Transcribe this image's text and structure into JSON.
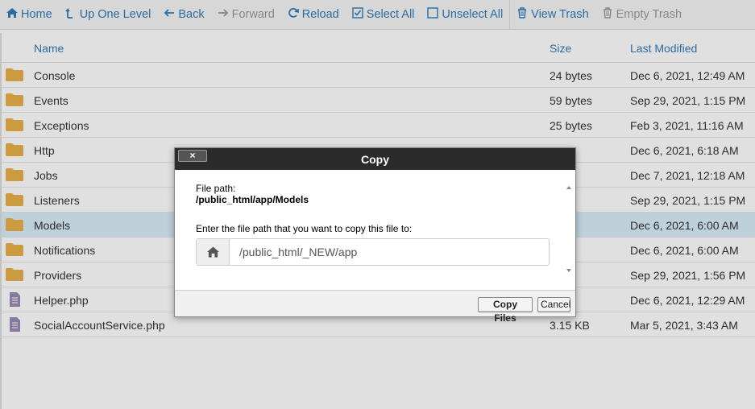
{
  "toolbar": {
    "items": [
      {
        "label": "Home",
        "icon": "home-icon",
        "disabled": false
      },
      {
        "label": "Up One Level",
        "icon": "level-up-icon",
        "disabled": false
      },
      {
        "label": "Back",
        "icon": "arrow-left-icon",
        "disabled": false
      },
      {
        "label": "Forward",
        "icon": "arrow-right-icon",
        "disabled": true
      },
      {
        "label": "Reload",
        "icon": "refresh-icon",
        "disabled": false
      },
      {
        "label": "Select All",
        "icon": "checkbox-checked-icon",
        "disabled": false
      },
      {
        "label": "Unselect All",
        "icon": "checkbox-empty-icon",
        "disabled": false
      },
      {
        "label": "View Trash",
        "icon": "trash-icon",
        "disabled": false
      },
      {
        "label": "Empty Trash",
        "icon": "trash-icon",
        "disabled": true
      }
    ]
  },
  "table": {
    "headers": {
      "name": "Name",
      "size": "Size",
      "modified": "Last Modified"
    },
    "rows": [
      {
        "name": "Console",
        "size": "24 bytes",
        "modified": "Dec 6, 2021, 12:49 AM",
        "type": "folder"
      },
      {
        "name": "Events",
        "size": "59 bytes",
        "modified": "Sep 29, 2021, 1:15 PM",
        "type": "folder"
      },
      {
        "name": "Exceptions",
        "size": "25 bytes",
        "modified": "Feb 3, 2021, 11:16 AM",
        "type": "folder"
      },
      {
        "name": "Http",
        "size": "",
        "modified": "Dec 6, 2021, 6:18 AM",
        "type": "folder"
      },
      {
        "name": "Jobs",
        "size": "",
        "modified": "Dec 7, 2021, 12:18 AM",
        "type": "folder"
      },
      {
        "name": "Listeners",
        "size": "",
        "modified": "Sep 29, 2021, 1:15 PM",
        "type": "folder"
      },
      {
        "name": "Models",
        "size": "",
        "modified": "Dec 6, 2021, 6:00 AM",
        "type": "folder",
        "selected": true
      },
      {
        "name": "Notifications",
        "size": "",
        "modified": "Dec 6, 2021, 6:00 AM",
        "type": "folder"
      },
      {
        "name": "Providers",
        "size": "",
        "modified": "Sep 29, 2021, 1:56 PM",
        "type": "folder"
      },
      {
        "name": "Helper.php",
        "size": "",
        "modified": "Dec 6, 2021, 12:29 AM",
        "type": "file"
      },
      {
        "name": "SocialAccountService.php",
        "size": "3.15 KB",
        "modified": "Mar 5, 2021, 3:43 AM",
        "type": "file"
      }
    ]
  },
  "dialog": {
    "title": "Copy",
    "close_label": "×",
    "file_path_label": "File path:",
    "file_path_value": "/public_html/app/Models",
    "prompt": "Enter the file path that you want to copy this file to:",
    "destination_value": "/public_html/_NEW/app",
    "copy_button": "Copy Files",
    "cancel_button": "Cancel"
  },
  "colors": {
    "link": "#337ab7",
    "folder": "#e8b04a",
    "file": "#9b8bb5",
    "selected_row": "#d9edf7",
    "dialog_title_bg": "#2b2b2b"
  }
}
